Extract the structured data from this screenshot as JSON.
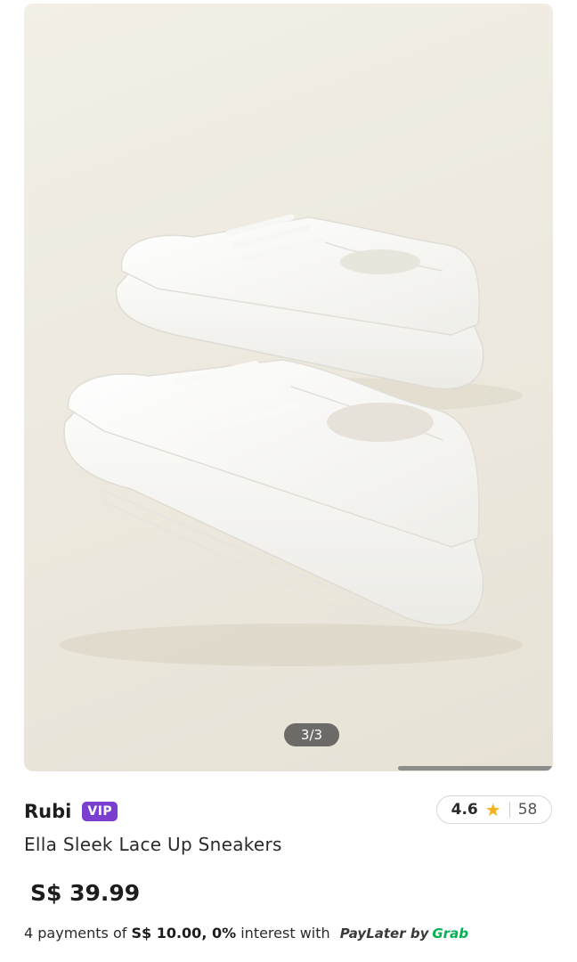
{
  "gallery": {
    "image_alt": "white lace up sneakers",
    "pager": "3/3"
  },
  "seller": {
    "name": "Rubi",
    "badge": "VIP"
  },
  "rating": {
    "value": "4.6",
    "icon": "star-icon",
    "count": "58"
  },
  "product": {
    "title": "Ella Sleek Lace Up Sneakers",
    "price": "S$ 39.99"
  },
  "installment": {
    "prefix": "4 payments of ",
    "amount": "S$ 10.00",
    "sep": ", ",
    "interest": "0%",
    "suffix": " interest with ",
    "paylater": "PayLater by",
    "provider": "Grab"
  },
  "colors": {
    "vip_badge": "#7b3fd0",
    "star": "#f2b01e",
    "grab": "#00b14f"
  }
}
